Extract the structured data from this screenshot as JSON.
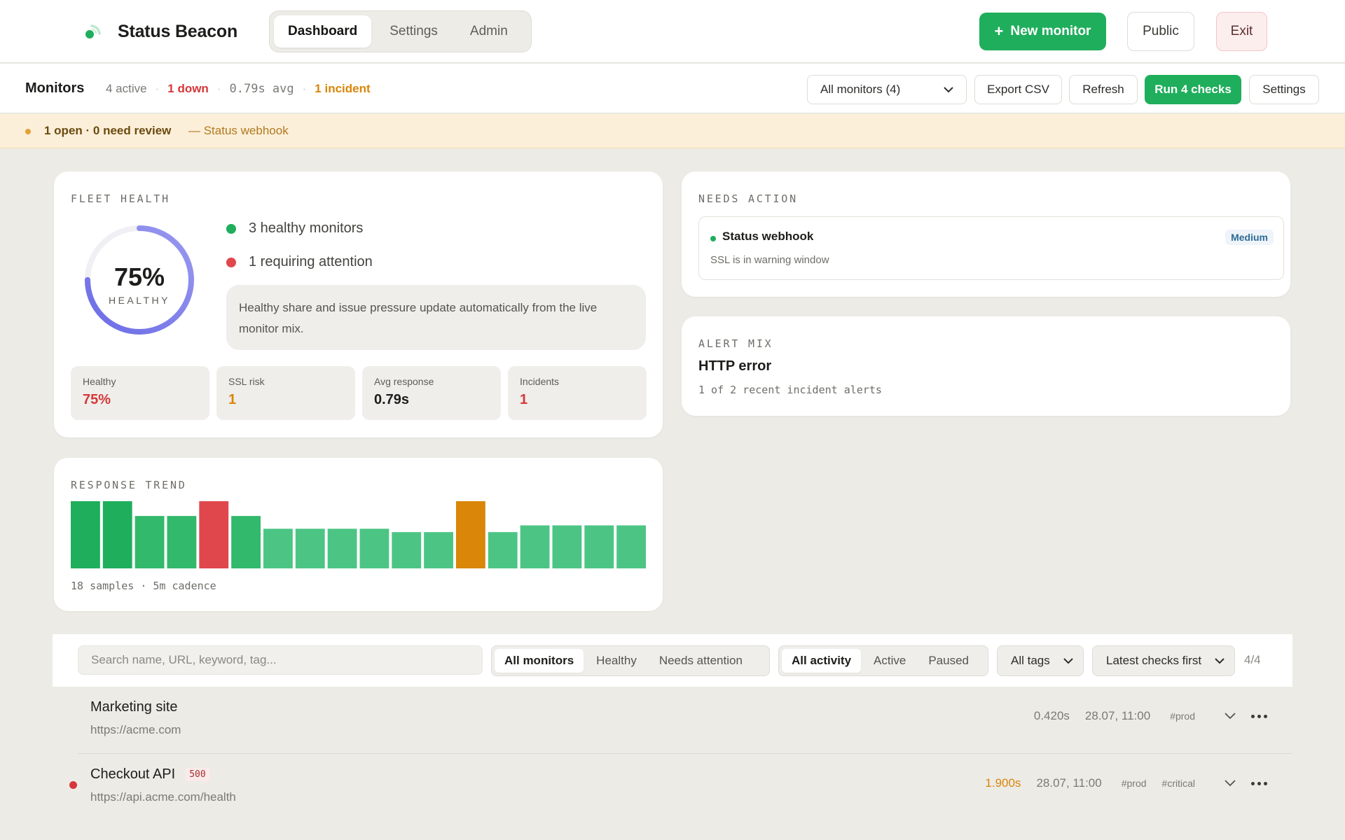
{
  "app": {
    "name": "Status Beacon"
  },
  "nav": {
    "tabs": [
      {
        "label": "Dashboard"
      },
      {
        "label": "Settings"
      },
      {
        "label": "Admin"
      }
    ]
  },
  "header": {
    "new_monitor": "New monitor",
    "public": "Public",
    "exit": "Exit"
  },
  "monitors_bar": {
    "title": "Monitors",
    "active": "4 active",
    "down": "1 down",
    "avg": "0.79s avg",
    "incident": "1 incident",
    "filter_selected": "All monitors (4)",
    "export": "Export CSV",
    "refresh": "Refresh",
    "run": "Run 4 checks",
    "settings": "Settings"
  },
  "banner": {
    "text": "1 open · 0 need review",
    "source": "— Status webhook"
  },
  "fleet": {
    "label": "FLEET HEALTH",
    "ring_value": 75,
    "percent": "75%",
    "percent_label": "HEALTHY",
    "healthy_text": "3 healthy monitors",
    "attention_text": "1 requiring attention",
    "note": "Healthy share and issue pressure update automatically from the live monitor mix.",
    "tiles": [
      {
        "label": "Healthy",
        "value": "75%",
        "color": "#d6373a"
      },
      {
        "label": "SSL risk",
        "value": "1",
        "color": "#d98609"
      },
      {
        "label": "Avg response",
        "value": "0.79s",
        "color": "#1d1d1b"
      },
      {
        "label": "Incidents",
        "value": "1",
        "color": "#d6373a"
      }
    ]
  },
  "needs_action": {
    "label": "NEEDS ACTION",
    "item_name": "Status webhook",
    "item_desc": "SSL is in warning window",
    "severity": "Medium"
  },
  "alert_mix": {
    "label": "ALERT MIX",
    "title": "HTTP error",
    "subtitle": "1 of 2 recent incident alerts"
  },
  "trend": {
    "label": "RESPONSE TREND",
    "footer": "18 samples · 5m cadence"
  },
  "chart_data": {
    "type": "bar",
    "values": [
      1.0,
      1.0,
      0.78,
      0.78,
      1.0,
      0.78,
      0.59,
      0.59,
      0.59,
      0.59,
      0.54,
      0.54,
      1.0,
      0.54,
      0.64,
      0.64,
      0.64,
      0.64
    ],
    "status": [
      "ok-dark",
      "ok-dark",
      "ok",
      "ok",
      "error",
      "ok",
      "ok-light",
      "ok-light",
      "ok-light",
      "ok-light",
      "ok-light",
      "ok-light",
      "warn",
      "ok-light",
      "ok-light",
      "ok-light",
      "ok-light",
      "ok-light"
    ],
    "colors": {
      "ok-dark": "#1fae5c",
      "ok": "#32b96b",
      "ok-light": "#4cc584",
      "error": "#e0474c",
      "warn": "#d98609"
    },
    "ylim": [
      0,
      1
    ]
  },
  "filters": {
    "search_placeholder": "Search name, URL, keyword, tag...",
    "status_tabs": [
      "All monitors",
      "Healthy",
      "Needs attention"
    ],
    "activity_tabs": [
      "All activity",
      "Active",
      "Paused"
    ],
    "tags": "All tags",
    "sort": "Latest checks first",
    "count": "4/4"
  },
  "monitors": [
    {
      "name": "Marketing site",
      "url": "https://acme.com",
      "response": "0.420s",
      "time": "28.07, 11:00",
      "tags": [
        "#prod"
      ]
    },
    {
      "name": "Checkout API",
      "code": "500",
      "url": "https://api.acme.com/health",
      "response": "1.900s",
      "time": "28.07, 11:00",
      "tags": [
        "#prod",
        "#critical"
      ]
    }
  ]
}
